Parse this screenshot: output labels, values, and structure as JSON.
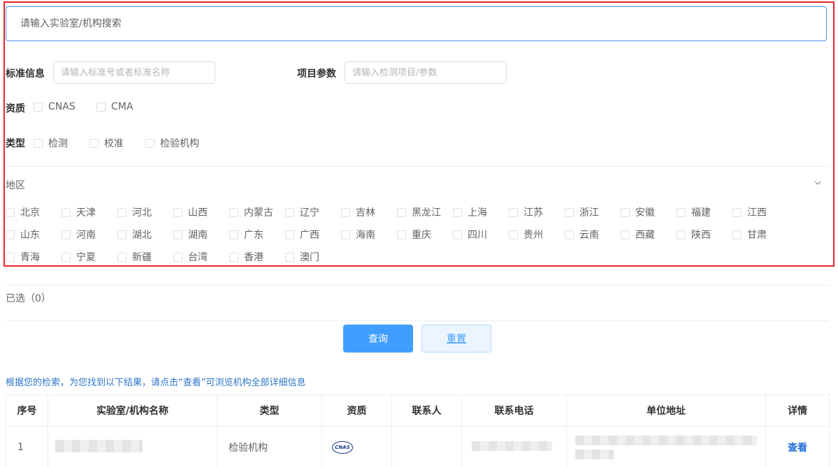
{
  "search": {
    "placeholder": "请输入实验室/机构搜索"
  },
  "filters": {
    "standard": {
      "label": "标准信息",
      "placeholder": "请输入标准号或者标准名称"
    },
    "project": {
      "label": "项目参数",
      "placeholder": "请输入检测项目/参数"
    },
    "qualification": {
      "label": "资质",
      "options": [
        "CNAS",
        "CMA"
      ]
    },
    "type": {
      "label": "类型",
      "options": [
        "检测",
        "校准",
        "检验机构"
      ]
    }
  },
  "region": {
    "label": "地区",
    "options": [
      "北京",
      "天津",
      "河北",
      "山西",
      "内蒙古",
      "辽宁",
      "吉林",
      "黑龙江",
      "上海",
      "江苏",
      "浙江",
      "安徽",
      "福建",
      "江西",
      "山东",
      "河南",
      "湖北",
      "湖南",
      "广东",
      "广西",
      "海南",
      "重庆",
      "四川",
      "贵州",
      "云南",
      "西藏",
      "陕西",
      "甘肃",
      "青海",
      "宁夏",
      "新疆",
      "台湾",
      "香港",
      "澳门"
    ]
  },
  "selected": {
    "label": "已选（0）"
  },
  "buttons": {
    "query": "查询",
    "reset": "重置"
  },
  "result_message": "根据您的检索，为您找到以下结果，请点击“查看”可浏览机构全部详细信息",
  "table": {
    "headers": [
      "序号",
      "实验室/机构名称",
      "类型",
      "资质",
      "联系人",
      "联系电话",
      "单位地址",
      "详情"
    ],
    "rows": [
      {
        "index": "1",
        "type": "检验机构",
        "qualification_logo": "CNAS",
        "action": "查看"
      }
    ]
  }
}
